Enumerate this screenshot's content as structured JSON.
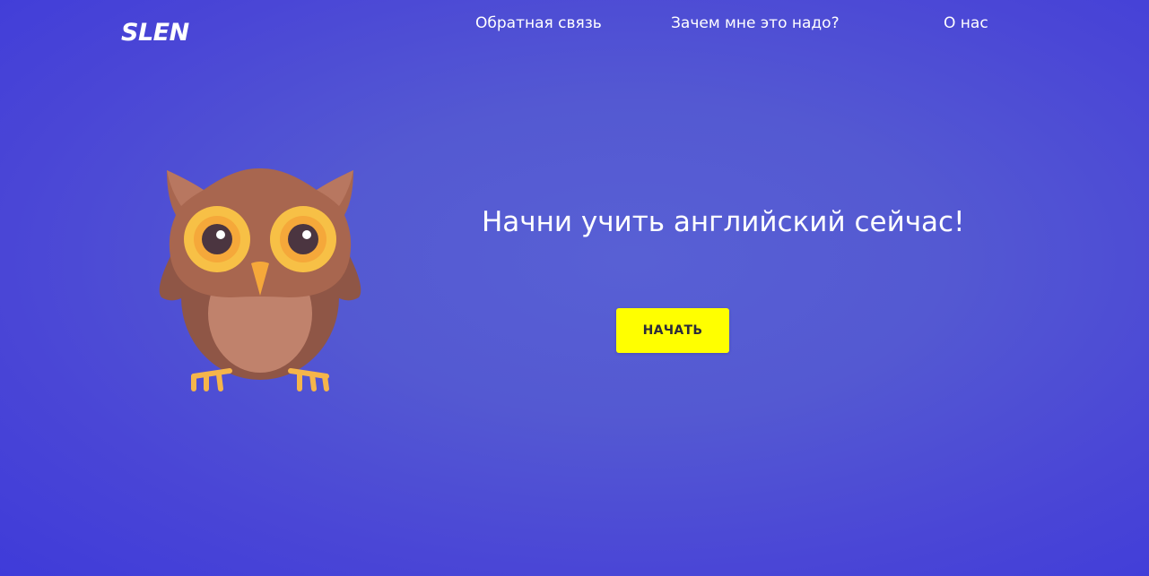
{
  "header": {
    "logo": "SLEN",
    "nav": [
      {
        "label": "Обратная связь"
      },
      {
        "label": "Зачем мне это надо?"
      },
      {
        "label": "О нас"
      }
    ]
  },
  "hero": {
    "image_icon": "owl-illustration",
    "headline": "Начни учить английский сейчас!",
    "cta_label": "НАЧАТЬ"
  },
  "colors": {
    "background": "#4f4fd6",
    "cta_background": "#ffff00",
    "owl_body": "#a0624f",
    "owl_belly": "#c0826c",
    "owl_eye_ring": "#f7c046"
  }
}
